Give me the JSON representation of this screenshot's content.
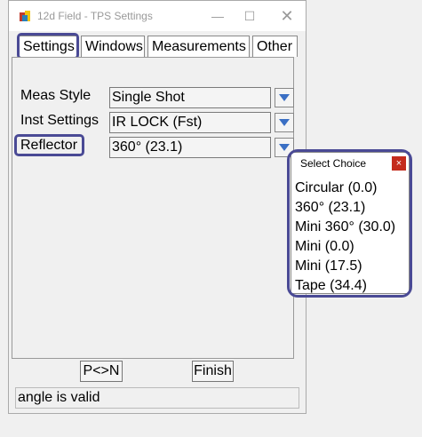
{
  "window": {
    "title": "12d Field - TPS Settings",
    "min_glyph": "—",
    "max_glyph": "☐",
    "close_glyph": "✕"
  },
  "tabs": [
    {
      "label": "Settings",
      "selected": true
    },
    {
      "label": "Windows"
    },
    {
      "label": "Measurements"
    },
    {
      "label": "Other"
    }
  ],
  "fields": [
    {
      "label": "Meas Style",
      "value": "Single Shot"
    },
    {
      "label": "Inst Settings",
      "value": "IR LOCK (Fst)"
    },
    {
      "label": "Reflector",
      "value": "360° (23.1)"
    }
  ],
  "buttons": {
    "pn": "P<>N",
    "finish": "Finish"
  },
  "status_text": "angle is valid",
  "popup": {
    "title": "Select Choice",
    "close_glyph": "×",
    "choices": [
      "Circular (0.0)",
      "360° (23.1)",
      "Mini 360° (30.0)",
      "Mini (0.0)",
      "Mini (17.5)",
      "Tape (34.4)"
    ]
  },
  "colors": {
    "highlight": "#4a4a95",
    "dropdown_arrow": "#3a6fc4",
    "close_red": "#c42b1c"
  }
}
